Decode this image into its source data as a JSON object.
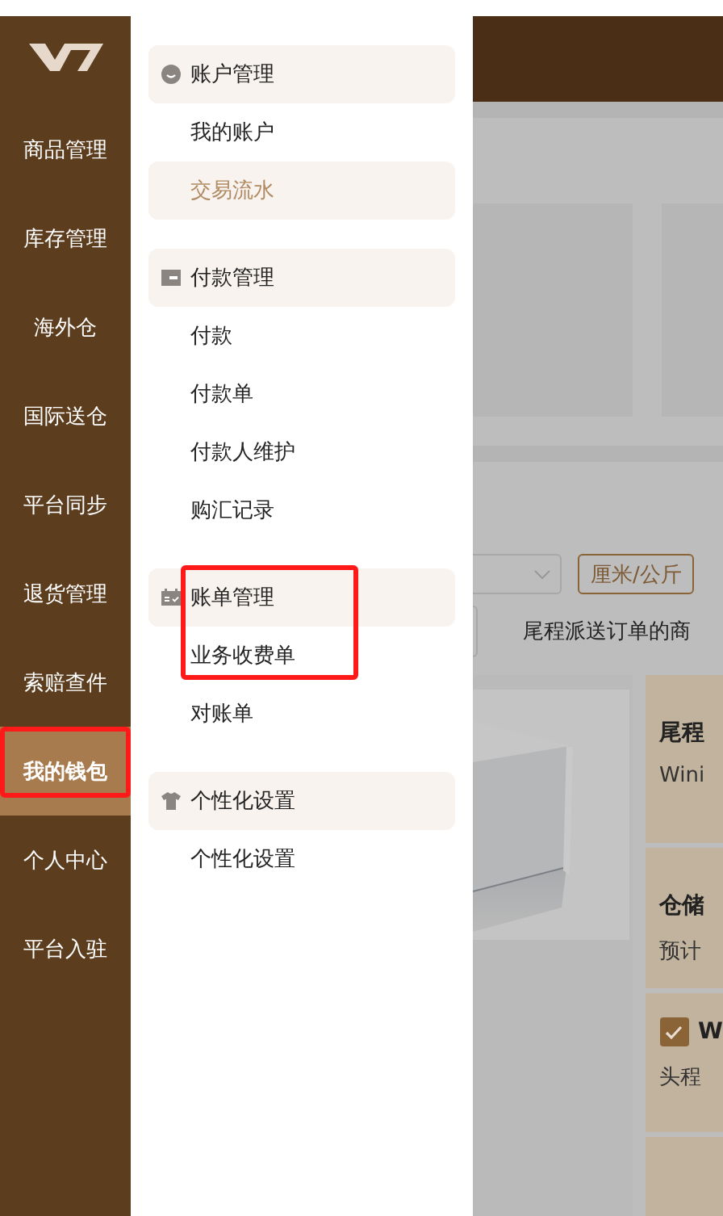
{
  "sidebar": {
    "items": [
      {
        "label": "商品管理",
        "selected": false,
        "annotated": false
      },
      {
        "label": "库存管理",
        "selected": false,
        "annotated": false
      },
      {
        "label": "海外仓",
        "selected": false,
        "annotated": false
      },
      {
        "label": "国际送仓",
        "selected": false,
        "annotated": false
      },
      {
        "label": "平台同步",
        "selected": false,
        "annotated": false
      },
      {
        "label": "退货管理",
        "selected": false,
        "annotated": false
      },
      {
        "label": "索赔查件",
        "selected": false,
        "annotated": false
      },
      {
        "label": "我的钱包",
        "selected": true,
        "annotated": true
      },
      {
        "label": "个人中心",
        "selected": false,
        "annotated": false
      },
      {
        "label": "平台入驻",
        "selected": false,
        "annotated": false
      }
    ]
  },
  "flyout": {
    "groups": [
      {
        "title": "账户管理",
        "annotated": false,
        "items": [
          {
            "label": "我的账户",
            "selected": false
          },
          {
            "label": "交易流水",
            "selected": true
          }
        ]
      },
      {
        "title": "付款管理",
        "annotated": false,
        "items": [
          {
            "label": "付款",
            "selected": false
          },
          {
            "label": "付款单",
            "selected": false
          },
          {
            "label": "付款人维护",
            "selected": false
          },
          {
            "label": "购汇记录",
            "selected": false
          }
        ]
      },
      {
        "title": "账单管理",
        "annotated": true,
        "items": [
          {
            "label": "业务收费单",
            "selected": false
          },
          {
            "label": "对账单",
            "selected": false
          }
        ]
      },
      {
        "title": "个性化设置",
        "annotated": false,
        "items": [
          {
            "label": "个性化设置",
            "selected": false
          }
        ]
      }
    ]
  },
  "main": {
    "unit_button": "厘米/公斤",
    "notice": "尾程派送订单的商",
    "cards": [
      {
        "kind": "text",
        "title": "尾程",
        "text": "Wini"
      },
      {
        "kind": "text",
        "title": "仓储",
        "text": "预计"
      },
      {
        "kind": "checkbox",
        "title": "W",
        "text": "头程",
        "checked": true
      },
      {
        "kind": "empty"
      }
    ]
  }
}
